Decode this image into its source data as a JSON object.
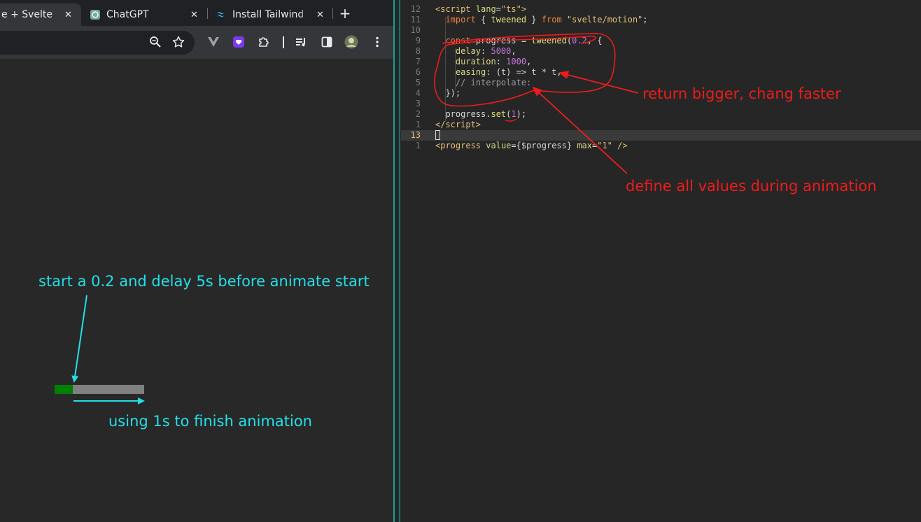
{
  "browser": {
    "tabs": [
      {
        "title": "e + Svelte",
        "icon": "svelte-icon",
        "active": true
      },
      {
        "title": "ChatGPT",
        "icon": "chatgpt-icon",
        "active": false
      },
      {
        "title": "Install Tailwind",
        "icon": "tailwind-icon",
        "active": false
      }
    ],
    "close_glyph": "✕",
    "new_tab_glyph": "+",
    "progress": {
      "value": 0.2,
      "max": 1
    }
  },
  "editor": {
    "lines": [
      {
        "num": "12",
        "html": "<span class=\"tag\">&lt;script</span> <span class=\"prop\">lang</span>=<span class=\"str\">\"ts\"</span><span class=\"tag\">&gt;</span>"
      },
      {
        "num": "11",
        "html": "  <span class=\"kw\">import</span> { <span class=\"fn\">tweened</span> } <span class=\"kw\">from</span> <span class=\"str\">\"svelte/motion\"</span>;"
      },
      {
        "num": "10",
        "html": ""
      },
      {
        "num": "9",
        "html": "  <span class=\"kw\">const</span> progress = <span class=\"fn\">tweened</span>(<span class=\"num\">0.2</span>, {"
      },
      {
        "num": "8",
        "html": "    <span class=\"prop\">delay</span>: <span class=\"num\">5000</span>,"
      },
      {
        "num": "7",
        "html": "    <span class=\"prop\">duration</span>: <span class=\"num\">1000</span>,"
      },
      {
        "num": "6",
        "html": "    <span class=\"prop\">easing</span>: (t) =&gt; t * t,"
      },
      {
        "num": "5",
        "html": "    <span class=\"cm\">// interpolate:</span>"
      },
      {
        "num": "4",
        "html": "  });"
      },
      {
        "num": "3",
        "html": ""
      },
      {
        "num": "2",
        "html": "  progress.<span class=\"fn\">set</span>(<span class=\"num\">1</span>);"
      },
      {
        "num": "1",
        "html": "<span class=\"tag\">&lt;/script&gt;</span>"
      },
      {
        "num": "13",
        "html": "<span class=\"cursor\"></span>",
        "current": true
      },
      {
        "num": "1",
        "html": "<span class=\"tag\">&lt;progress</span> <span class=\"prop\">value</span>={$progress} <span class=\"prop\">max</span>=<span class=\"str\">\"1\"</span> <span class=\"tag\">/&gt;</span>"
      }
    ]
  },
  "annotations": {
    "start_note": "start a 0.2 and delay 5s before animate start",
    "duration_note": "using 1s to finish animation",
    "easing_note": "return bigger, chang faster",
    "interpolate_note": "define all values during animation",
    "cyan": "#22e0e8",
    "red": "#ee1c1c"
  }
}
